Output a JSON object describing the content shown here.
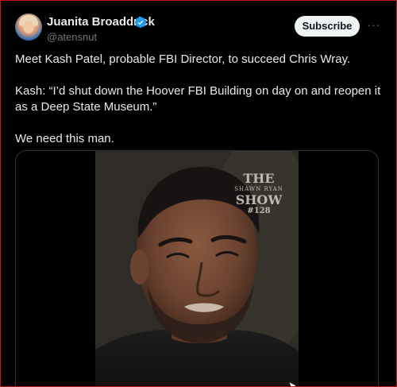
{
  "author": {
    "name": "Juanita Broaddrick",
    "handle": "@atensnut",
    "verified": true,
    "verified_color": "#1d9bf0"
  },
  "actions": {
    "subscribe_label": "Subscribe",
    "more_label": "···"
  },
  "tweet": {
    "paragraphs": [
      "Meet Kash Patel, probable FBI Director, to succeed Chris Wray.",
      "Kash:  “I’d shut down the Hoover FBI Building on day on and reopen it as a Deep State Museum.”",
      "We need this man."
    ]
  },
  "media": {
    "watermark": {
      "line1": "THE",
      "line2": "SHAWN RYAN",
      "line3": "SHOW",
      "line4": "#128"
    }
  },
  "colors": {
    "background": "#000000",
    "text": "#e7e9ea",
    "secondary_text": "#71767b",
    "border": "#2f3336",
    "button_bg": "#eff3f4"
  }
}
